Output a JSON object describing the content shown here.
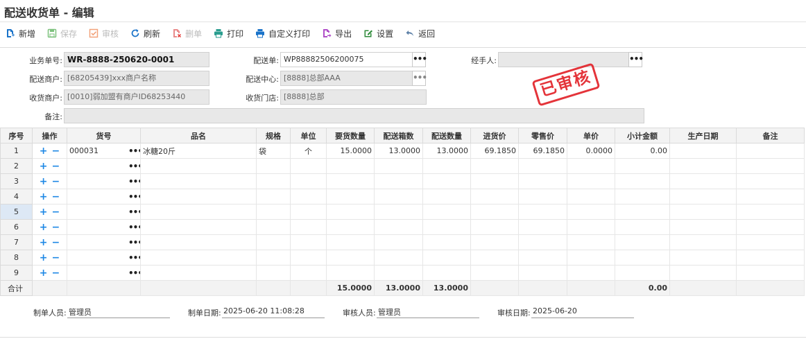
{
  "window": {
    "title": "配送收货单 - 编辑"
  },
  "toolbar": {
    "new": "新增",
    "save": "保存",
    "audit": "审核",
    "refresh": "刷新",
    "delete": "删单",
    "print": "打印",
    "custom_print": "自定义打印",
    "export": "导出",
    "settings": "设置",
    "back": "返回"
  },
  "form": {
    "doc_no": {
      "label": "业务单号:",
      "value": "WR-8888-250620-0001"
    },
    "delivery_no": {
      "label": "配送单:",
      "value": "WP88882506200075"
    },
    "handler": {
      "label": "经手人:",
      "value": ""
    },
    "delivery_merchant": {
      "label": "配送商户:",
      "value": "[68205439]xxx商户名称"
    },
    "delivery_center": {
      "label": "配送中心:",
      "value": "[8888]总部AAA"
    },
    "receiving_merchant": {
      "label": "收货商户:",
      "value": "[0010]弱加盟有商户ID68253440"
    },
    "receiving_store": {
      "label": "收货门店:",
      "value": "[8888]总部"
    },
    "remark": {
      "label": "备注:",
      "value": ""
    }
  },
  "stamp": {
    "text": "已审核",
    "color": "#e2232a"
  },
  "table": {
    "headers": [
      "序号",
      "操作",
      "货号",
      "品名",
      "规格",
      "单位",
      "要货数量",
      "配送箱数",
      "配送数量",
      "进货价",
      "零售价",
      "单价",
      "小计金额",
      "生产日期",
      "备注"
    ],
    "rows": [
      {
        "seq": "1",
        "code": "000031",
        "name": "冰糖20斤",
        "spec": "袋",
        "unit": "个",
        "req_qty": "15.0000",
        "boxes": "13.0000",
        "qty": "13.0000",
        "cost": "69.1850",
        "retail": "69.1850",
        "price": "0.0000",
        "subtotal": "0.00",
        "date": "",
        "remark": ""
      },
      {
        "seq": "2",
        "code": "",
        "name": "",
        "spec": "",
        "unit": "",
        "req_qty": "",
        "boxes": "",
        "qty": "",
        "cost": "",
        "retail": "",
        "price": "",
        "subtotal": "",
        "date": "",
        "remark": ""
      },
      {
        "seq": "3",
        "code": "",
        "name": "",
        "spec": "",
        "unit": "",
        "req_qty": "",
        "boxes": "",
        "qty": "",
        "cost": "",
        "retail": "",
        "price": "",
        "subtotal": "",
        "date": "",
        "remark": ""
      },
      {
        "seq": "4",
        "code": "",
        "name": "",
        "spec": "",
        "unit": "",
        "req_qty": "",
        "boxes": "",
        "qty": "",
        "cost": "",
        "retail": "",
        "price": "",
        "subtotal": "",
        "date": "",
        "remark": ""
      },
      {
        "seq": "5",
        "code": "",
        "name": "",
        "spec": "",
        "unit": "",
        "req_qty": "",
        "boxes": "",
        "qty": "",
        "cost": "",
        "retail": "",
        "price": "",
        "subtotal": "",
        "date": "",
        "remark": ""
      },
      {
        "seq": "6",
        "code": "",
        "name": "",
        "spec": "",
        "unit": "",
        "req_qty": "",
        "boxes": "",
        "qty": "",
        "cost": "",
        "retail": "",
        "price": "",
        "subtotal": "",
        "date": "",
        "remark": ""
      },
      {
        "seq": "7",
        "code": "",
        "name": "",
        "spec": "",
        "unit": "",
        "req_qty": "",
        "boxes": "",
        "qty": "",
        "cost": "",
        "retail": "",
        "price": "",
        "subtotal": "",
        "date": "",
        "remark": ""
      },
      {
        "seq": "8",
        "code": "",
        "name": "",
        "spec": "",
        "unit": "",
        "req_qty": "",
        "boxes": "",
        "qty": "",
        "cost": "",
        "retail": "",
        "price": "",
        "subtotal": "",
        "date": "",
        "remark": ""
      },
      {
        "seq": "9",
        "code": "",
        "name": "",
        "spec": "",
        "unit": "",
        "req_qty": "",
        "boxes": "",
        "qty": "",
        "cost": "",
        "retail": "",
        "price": "",
        "subtotal": "",
        "date": "",
        "remark": ""
      }
    ],
    "totals": {
      "label": "合计",
      "req_qty": "15.0000",
      "boxes": "13.0000",
      "qty": "13.0000",
      "subtotal": "0.00"
    },
    "selected_row": "5"
  },
  "footer": {
    "creator": {
      "label": "制单人员:",
      "value": "管理员"
    },
    "create_date": {
      "label": "制单日期:",
      "value": "2025-06-20 11:08:28"
    },
    "auditor": {
      "label": "审核人员:",
      "value": "管理员"
    },
    "audit_date": {
      "label": "审核日期:",
      "value": "2025-06-20"
    }
  },
  "icons": {
    "new": "new-doc-icon",
    "save": "save-icon",
    "audit": "audit-check-icon",
    "refresh": "refresh-icon",
    "delete": "delete-doc-icon",
    "print": "printer-icon",
    "custom_print": "custom-printer-icon",
    "export": "export-icon",
    "settings": "settings-edit-icon",
    "back": "back-arrow-icon"
  }
}
